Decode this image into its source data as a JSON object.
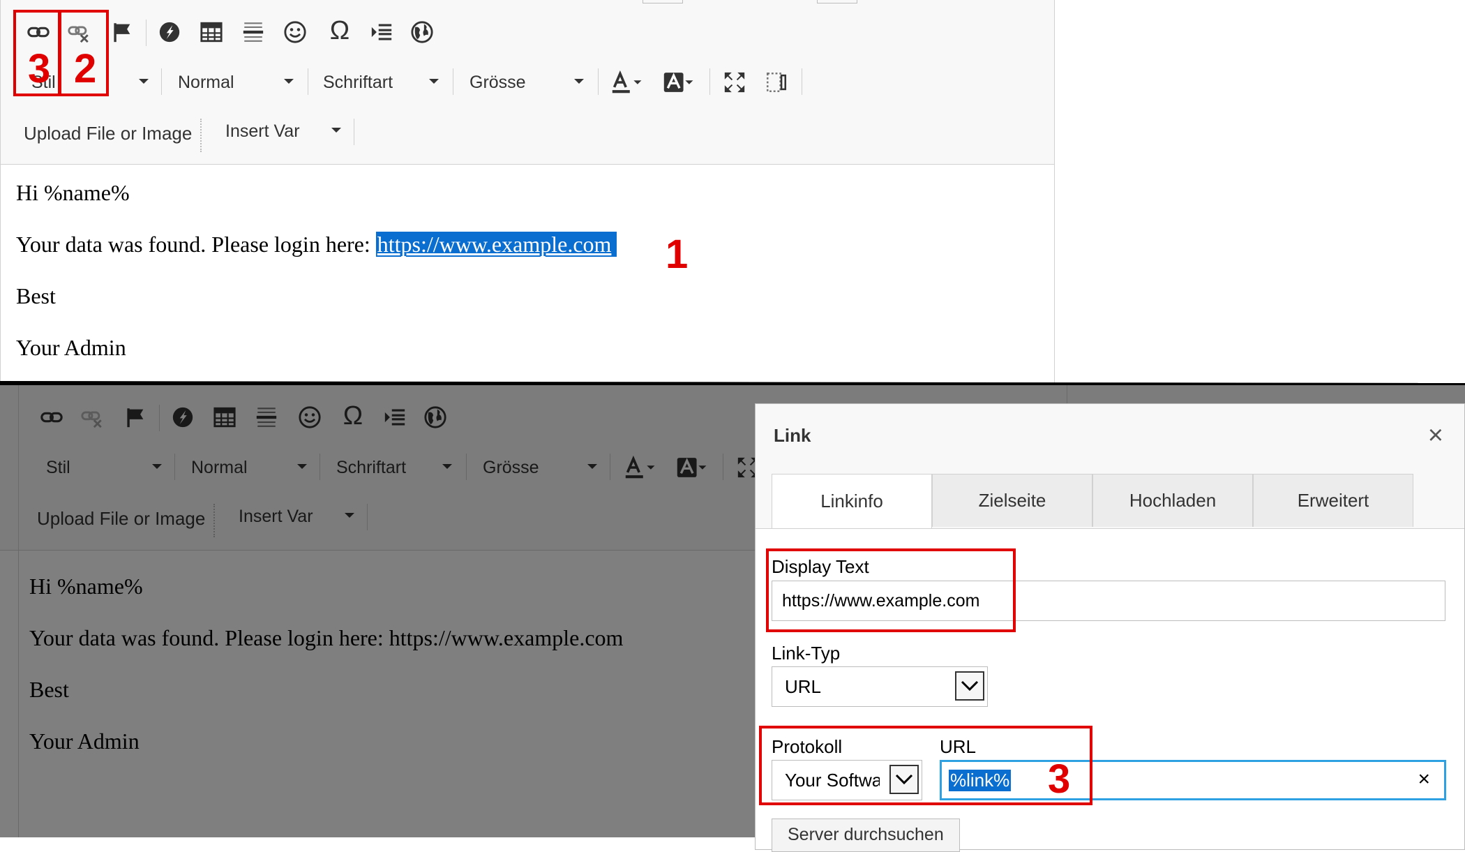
{
  "toolbar": {
    "style_label": "Stil",
    "format_label": "Normal",
    "font_label": "Schriftart",
    "size_label": "Grösse",
    "upload_label": "Upload File or Image",
    "insert_var_label": "Insert Var"
  },
  "content": {
    "greeting": "Hi %name%",
    "line_prefix": "Your data was found. Please login here: ",
    "link_text": "https://www.example.com",
    "closing": "Best",
    "signature": "Your Admin"
  },
  "annotations": {
    "num1": "1",
    "num2": "2",
    "num3": "3",
    "color": "#e00000"
  },
  "dialog": {
    "title": "Link",
    "close_glyph": "×",
    "tabs": [
      "Linkinfo",
      "Zielseite",
      "Hochladen",
      "Erweitert"
    ],
    "display_text_label": "Display Text",
    "display_text_value": "https://www.example.com",
    "link_type_label": "Link-Typ",
    "link_type_value": "URL",
    "protocol_label": "Protokoll",
    "protocol_value": "Your Software",
    "url_label": "URL",
    "url_value": "%link%",
    "clear_glyph": "×",
    "server_button": "Server durchsuchen"
  },
  "icons": [
    "link-icon",
    "unlink-icon",
    "anchor-flag-icon",
    "flash-icon",
    "table-icon",
    "horizontal-line-icon",
    "smiley-icon",
    "omega-icon",
    "page-break-icon",
    "globe-icon",
    "text-color-icon",
    "bg-color-icon",
    "maximize-icon",
    "show-blocks-icon"
  ]
}
